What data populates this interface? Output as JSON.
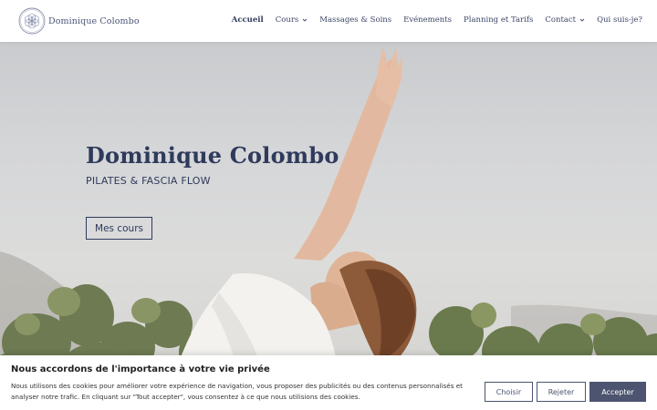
{
  "header": {
    "logo_text": "Dominique Colombo",
    "nav": [
      {
        "label": "Accueil",
        "active": true,
        "dropdown": false
      },
      {
        "label": "Cours",
        "active": false,
        "dropdown": true
      },
      {
        "label": "Massages & Soins",
        "active": false,
        "dropdown": false
      },
      {
        "label": "Evénements",
        "active": false,
        "dropdown": false
      },
      {
        "label": "Planning et Tarifs",
        "active": false,
        "dropdown": false
      },
      {
        "label": "Contact",
        "active": false,
        "dropdown": true
      },
      {
        "label": "Qui suis-je?",
        "active": false,
        "dropdown": false
      }
    ]
  },
  "hero": {
    "title": "Dominique Colombo",
    "subtitle": "PILATES & FASCIA FLOW",
    "button_label": "Mes cours"
  },
  "cookie": {
    "title": "Nous accordons de l'importance à votre vie privée",
    "text": "Nous utilisons des cookies pour améliorer votre expérience de navigation, vous proposer des publicités ou des contenus personnalisés et analyser notre trafic. En cliquant sur \"Tout accepter\", vous consentez à ce que nous utilisions des cookies.",
    "buttons": {
      "customize": "Choisir",
      "reject": "Rejeter",
      "accept": "Accepter"
    }
  },
  "colors": {
    "brand": "#2f3a5c",
    "cookie_accept": "#4d5470"
  },
  "icons": {
    "logo": "flower-of-life-icon",
    "dropdown": "chevron-down-icon"
  }
}
